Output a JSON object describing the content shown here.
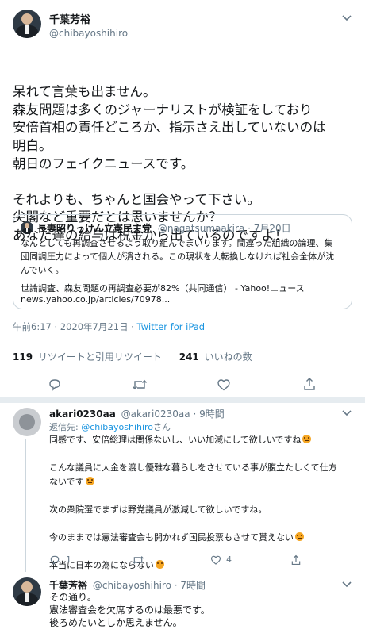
{
  "main_tweet": {
    "author_name": "千葉芳裕",
    "author_handle": "@chibayoshihiro",
    "text_lines": [
      "呆れて言葉も出ません。",
      "森友問題は多くのジャーナリストが検証をしており",
      "安倍首相の責任どころか、指示さえ出していないのは",
      "明白。",
      "朝日のフェイクニュースです。",
      "",
      "それよりも、ちゃんと国会やって下さい。",
      "尖閣など重要だとは思いませんか？",
      "あなた達の給与は税金から出ているのですよ！"
    ],
    "timestamp": "午前6:17 · 2020年7月21日 · ",
    "source": "Twitter for iPad",
    "retweets_count": "119",
    "retweets_label": "リツイートと引用リツイート",
    "likes_count": "241",
    "likes_label": "いいねの数"
  },
  "quoted_tweet": {
    "author_name": "長妻昭りっけん立憲民主党",
    "author_handle": "@nagatsumaakira",
    "date": "· 7月20日",
    "text_lines": [
      "なんとしても再調査させるよう取り組んでまいります。間違った組織の論理、集",
      "団同調圧力によって個人が潰される。この現状を大転換しなければ社会全体が沈",
      "んでいく。"
    ],
    "link_title": "世論調査、森友問題の再調査必要が82%（共同通信） - Yahoo!ニュース",
    "link_url": "news.yahoo.co.jp/articles/70978..."
  },
  "reply_1": {
    "author_name": "akari0230aa",
    "author_handle": "@akari0230aa",
    "time": "· 9時間",
    "reply_to_prefix": "返信先: ",
    "reply_to_handle": "@chibayoshihiro",
    "reply_to_suffix": "さん",
    "lines": [
      "同感です、安倍総理は関係ないし、いい加減にして欲しいですね",
      "",
      "こんな議員に大金を渡し優雅な暮らしをさせている事が腹立たしくて仕方",
      "ないです",
      "",
      "次の衆院選でまずは野党議員が激減して欲しいですね。",
      "",
      "今のままでは憲法審査会も開かれず国民投票もさせて貰えない",
      "",
      "本当に日本の為にならない"
    ],
    "reply_count": "1",
    "like_count": "4"
  },
  "reply_2": {
    "author_name": "千葉芳裕",
    "author_handle": "@chibayoshihiro",
    "time": "· 7時間",
    "lines": [
      "その通り。",
      "憲法審査会を欠席するのは最悪です。",
      "後ろめたいとしか思えません。"
    ]
  },
  "colors": {
    "accent": "#1b95e0",
    "muted": "#657786",
    "divider": "#e6ecf0"
  },
  "icons": [
    "chevron-down-icon",
    "reply-icon",
    "retweet-icon",
    "like-icon",
    "share-icon",
    "angry-emoji-icon"
  ]
}
